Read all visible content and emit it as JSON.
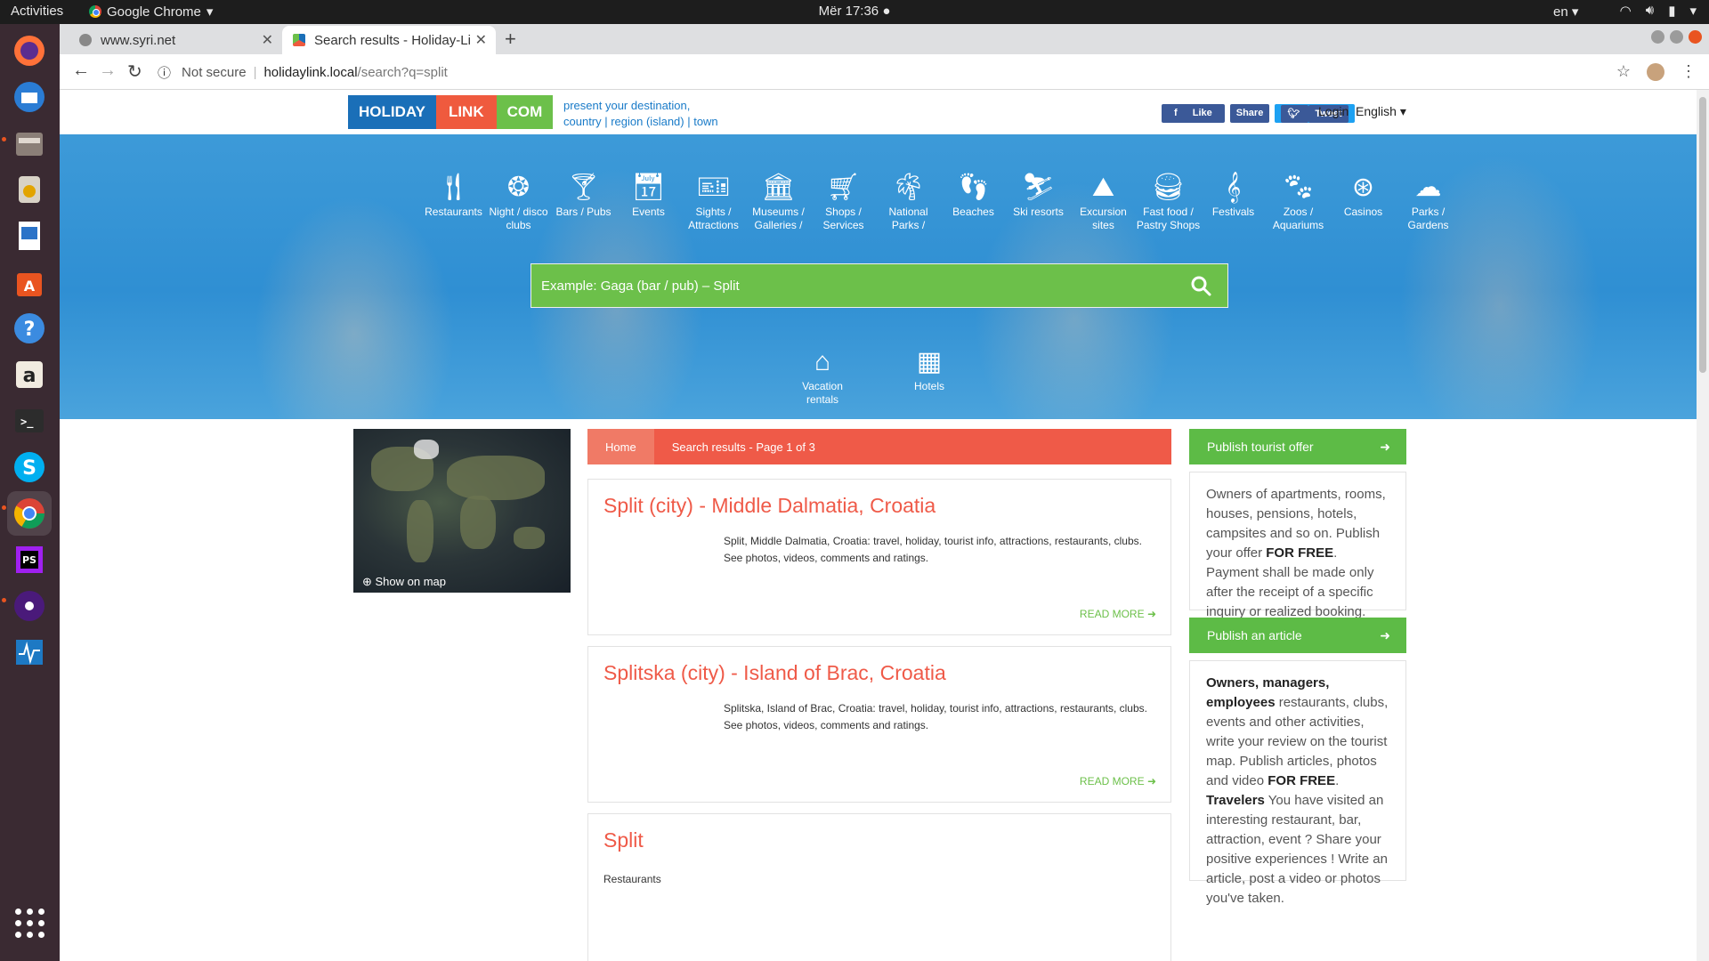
{
  "topbar": {
    "activities": "Activities",
    "app_name": "Google Chrome",
    "clock": "Mër 17:36",
    "input_lang": "en"
  },
  "browser": {
    "tabs": [
      {
        "title": "www.syri.net"
      },
      {
        "title": "Search results - Holiday-Li"
      }
    ],
    "security": "Not secure",
    "url_host": "holidaylink.local",
    "url_path": "/search?q=split"
  },
  "site": {
    "logo": {
      "part1": "HOLIDAY",
      "part2": "LINK",
      "part3": "COM"
    },
    "tagline_line1": "present your destination,",
    "tagline_line2": "country | region (island) | town",
    "social": {
      "like": "Like",
      "share": "Share",
      "tweet": "Tweet"
    },
    "login": "Login",
    "language": "English"
  },
  "categories": [
    {
      "label": "Restaurants",
      "icon": "cutlery-icon"
    },
    {
      "label": "Night / disco clubs",
      "icon": "disco-ball-icon"
    },
    {
      "label": "Bars / Pubs",
      "icon": "cocktail-icon"
    },
    {
      "label": "Events",
      "icon": "calendar-icon"
    },
    {
      "label": "Sights / Attractions",
      "icon": "tickets-icon"
    },
    {
      "label": "Museums / Galleries /",
      "icon": "museum-icon"
    },
    {
      "label": "Shops / Services",
      "icon": "basket-icon"
    },
    {
      "label": "National Parks /",
      "icon": "palm-tree-icon"
    },
    {
      "label": "Beaches",
      "icon": "flip-flops-icon"
    },
    {
      "label": "Ski resorts",
      "icon": "skier-icon"
    },
    {
      "label": "Excursion sites",
      "icon": "excursion-icon"
    },
    {
      "label": "Fast food / Pastry Shops",
      "icon": "burger-icon"
    },
    {
      "label": "Festivals",
      "icon": "music-icon"
    },
    {
      "label": "Zoos / Aquariums",
      "icon": "paw-icon"
    },
    {
      "label": "Casinos",
      "icon": "casino-chip-icon"
    },
    {
      "label": "Parks / Gardens",
      "icon": "tree-icon"
    }
  ],
  "search": {
    "placeholder": "Example: Gaga (bar / pub) – Split"
  },
  "sub_categories": [
    {
      "label": "Vacation rentals",
      "icon": "house-icon"
    },
    {
      "label": "Hotels",
      "icon": "hotel-icon"
    }
  ],
  "map": {
    "show_label": "Show on map"
  },
  "breadcrumb": {
    "home": "Home",
    "current": "Search results - Page 1 of 3"
  },
  "results": [
    {
      "title": "Split (city) - Middle Dalmatia, Croatia",
      "desc": "Split, Middle Dalmatia, Croatia: travel, holiday, tourist info, attractions, restaurants, clubs. See photos, videos, comments and ratings.",
      "more": "READ MORE"
    },
    {
      "title": "Splitska (city) - Island of Brac, Croatia",
      "desc": "Splitska, Island of Brac, Croatia: travel, holiday, tourist info, attractions, restaurants, clubs. See photos, videos, comments and ratings.",
      "more": "READ MORE"
    },
    {
      "title": "Split",
      "category": "Restaurants"
    }
  ],
  "sidebar": {
    "publish_offer": "Publish tourist offer",
    "offer_text_a": "Owners of apartments, rooms, houses, pensions, hotels, campsites and so on. Publish your offer ",
    "offer_bold": "FOR FREE",
    "offer_text_b": ". Payment shall be made only after the receipt of a specific inquiry or realized booking.",
    "publish_article": "Publish an article",
    "article_bold1": "Owners, managers, employees",
    "article_text1": " restaurants, clubs, events and other activities, write your review on the tourist map. Publish articles, photos and video ",
    "article_bold2": "FOR FREE",
    "article_text2": ".",
    "article_bold3": "Travelers",
    "article_text3": " You have visited an interesting restaurant, bar, attraction, event ? Share your positive experiences ! Write an article, post a video or photos you've taken."
  }
}
